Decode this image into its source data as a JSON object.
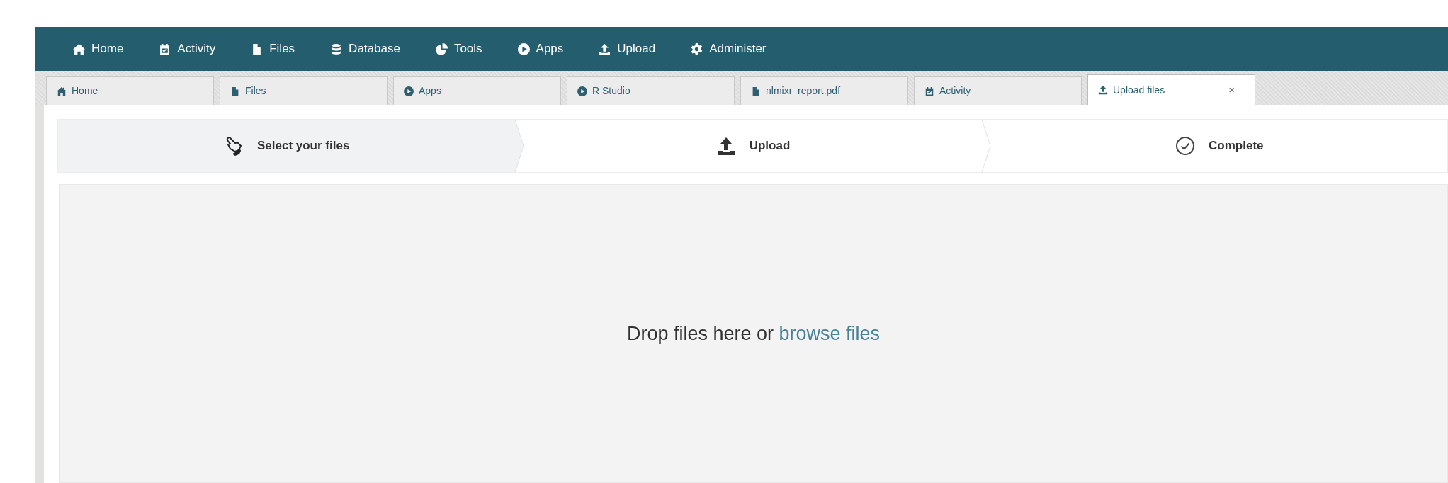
{
  "top_nav": [
    {
      "label": "Home"
    },
    {
      "label": "Activity"
    },
    {
      "label": "Files"
    },
    {
      "label": "Database"
    },
    {
      "label": "Tools"
    },
    {
      "label": "Apps"
    },
    {
      "label": "Upload"
    },
    {
      "label": "Administer"
    }
  ],
  "tabs": [
    {
      "label": "Home",
      "selected": false
    },
    {
      "label": "Files",
      "selected": false
    },
    {
      "label": "Apps",
      "selected": false
    },
    {
      "label": "R Studio",
      "selected": false
    },
    {
      "label": "nlmixr_report.pdf",
      "selected": false
    },
    {
      "label": "Activity",
      "selected": false
    },
    {
      "label": "Upload files",
      "selected": true,
      "close": "×"
    }
  ],
  "steps": [
    {
      "label": "Select your files",
      "selected": true
    },
    {
      "label": "Upload",
      "selected": false
    },
    {
      "label": "Complete",
      "selected": false
    }
  ],
  "drop_zone": {
    "text": "Drop files here or",
    "link": "browse files"
  }
}
